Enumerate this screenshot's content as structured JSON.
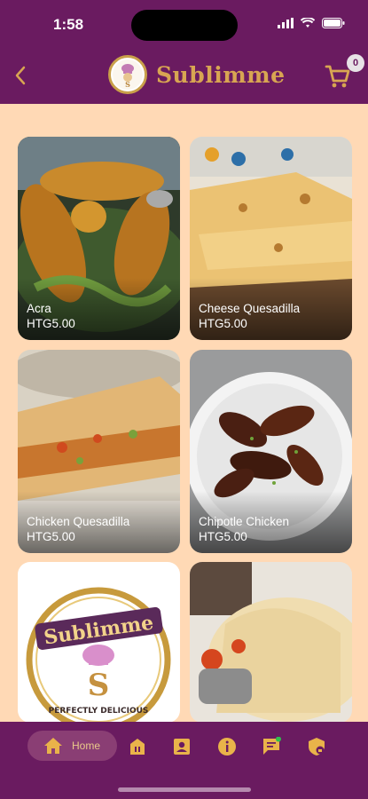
{
  "status": {
    "time": "1:58"
  },
  "header": {
    "title": "Sublimme",
    "cart_count": "0"
  },
  "items": [
    {
      "name": "Acra",
      "price": "HTG5.00"
    },
    {
      "name": "Cheese Quesadilla",
      "price": "HTG5.00"
    },
    {
      "name": "Chicken Quesadilla",
      "price": "HTG5.00"
    },
    {
      "name": "Chipotle Chicken",
      "price": "HTG5.00"
    }
  ],
  "logo_card": {
    "brand": "Sublimme",
    "letter": "S",
    "tagline": "PERFECTLY DELICIOUS"
  },
  "nav": {
    "home_label": "Home"
  },
  "colors": {
    "primary": "#6A1B60",
    "accent": "#D8A552",
    "background": "#FFD9B5"
  }
}
